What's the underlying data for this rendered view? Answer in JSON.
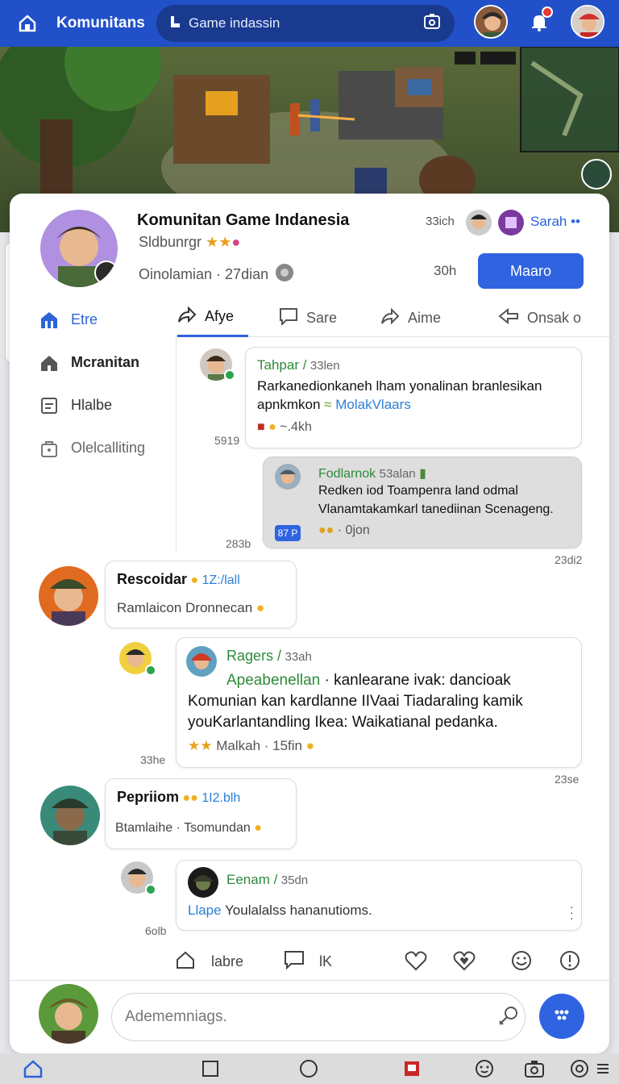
{
  "topbar": {
    "app_name": "Komunitans",
    "search_placeholder": "Game indassin"
  },
  "header": {
    "title": "Komunitan Game Indanesia",
    "subtitle": "Sldbunrgr",
    "meta_text": "Oinolamian · 27dian",
    "time_top": "33ich",
    "time_bottom": "30h",
    "user_name": "Sarah",
    "join_label": "Maaro"
  },
  "sidebar": {
    "items": [
      {
        "label": "Etre"
      },
      {
        "label": "Mcranitan"
      },
      {
        "label": "Hlalbe"
      },
      {
        "label": "Olelcalliting"
      }
    ]
  },
  "tabs": [
    {
      "label": "Afye"
    },
    {
      "label": "Sare"
    },
    {
      "label": "Aime"
    },
    {
      "label": "Onsak o"
    }
  ],
  "messages": {
    "m1": {
      "name": "Tahpar /",
      "meta": "33len",
      "line1": "Rarkanedionkaneh lham yonalinan branlesikan",
      "line2_text": "apnkmkon",
      "line2_link": "MolakVlaars",
      "reactions": "~.4kh",
      "side_time": "5919"
    },
    "m2": {
      "name": "Fodlarnok",
      "meta": "53alan",
      "line1": "Redken iod Toampenra land odmal",
      "line2": "Vlanamtakamkarl tanediinan Scenageng.",
      "reactions": "· 0jon",
      "badge": "87 P",
      "side_time": "283b",
      "right_time": "23di2"
    },
    "m3": {
      "name": "Rescoidar",
      "meta": "1Z:/lall",
      "body": "Ramlaicon Dronnecan"
    },
    "m4": {
      "name": "Ragers /",
      "meta": "33ah",
      "line1_link": "Apeabenellan",
      "line1_text": "· kanlearane ivak: dancioak",
      "line2": "Komunian kan kardlanne IIVaai Tiadaraling kamik",
      "line3": "youKarlantandling  Ikea: Waikatianal pedanka.",
      "footer": "Malkah · 15fin",
      "side_time": "33he",
      "right_time": "23se"
    },
    "m5": {
      "name": "Pepriiom",
      "meta": "1I2.blh",
      "body": "Btamlaihe · Tsomundan"
    },
    "m6": {
      "name": "Eenam /",
      "meta": "35dn",
      "body_link": "Llape",
      "body_text": "Youlalalss hananutioms.",
      "side_time": "6olb"
    }
  },
  "actions": {
    "home_label": "labre",
    "chat_label": "lK"
  },
  "composer": {
    "placeholder": "Adememniags."
  },
  "colors": {
    "brand": "#2150c8",
    "accent": "#2f63e0",
    "online": "#2ea44f",
    "name_green": "#2e8b3a"
  }
}
